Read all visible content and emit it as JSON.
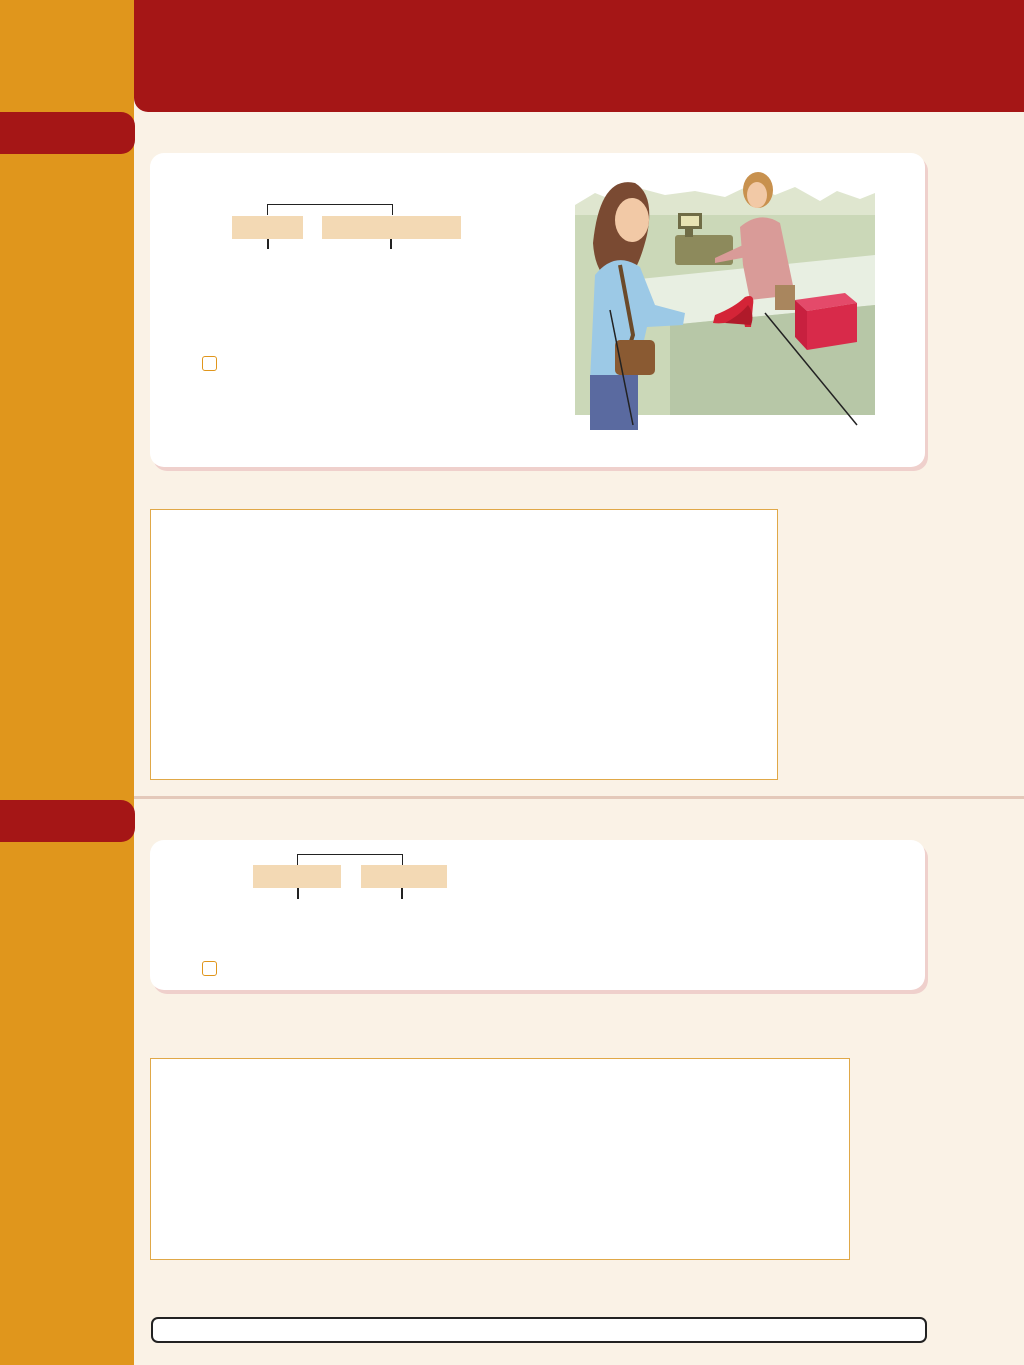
{
  "header": {
    "title": ""
  },
  "section_1": {
    "tab_label": ""
  },
  "section_2": {
    "tab_label": ""
  },
  "colors": {
    "sidebar": "#e0961c",
    "header": "#a51616",
    "page": "#faf2e6",
    "blank_fill": "#f3d9b4"
  },
  "illustration": {
    "subject": "shoe-store-checkout",
    "icons": [
      "customer-figure",
      "clerk-figure",
      "cash-register-icon",
      "red-shoes-icon",
      "shoe-box-icon"
    ]
  }
}
